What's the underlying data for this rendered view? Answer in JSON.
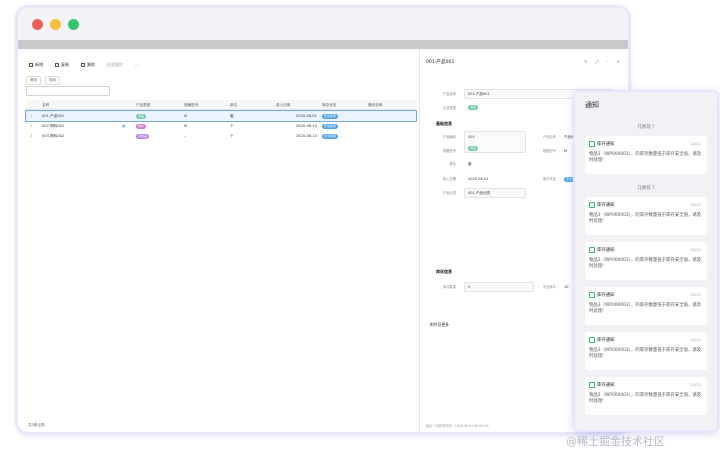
{
  "toolbar": {
    "new": "新增",
    "copy": "复制",
    "del": "删除",
    "filter_btn": "批量删除",
    "more": "⋯"
  },
  "filters": {
    "a": "筛选",
    "b": "排序",
    "c": "全部"
  },
  "table": {
    "headers": [
      "",
      "名称",
      "",
      "产品类型",
      "规格型号",
      "单位",
      "录入日期",
      "库存状态",
      "操作说明"
    ],
    "rows": [
      {
        "idx": "1",
        "name": "001-产品001",
        "type": "成品",
        "model": "M",
        "unit": "套",
        "date": "2020-06-01",
        "status": "安全库存"
      },
      {
        "idx": "2",
        "name": "002-物料001",
        "type": "物料",
        "model": "M",
        "unit": "个",
        "date": "2020-06-10",
        "status": "安全库存"
      },
      {
        "idx": "3",
        "name": "003-物料002",
        "type": "半成品",
        "model": "–",
        "unit": "个",
        "date": "2020-06-14",
        "status": "安全库存"
      }
    ],
    "footer": "共3条记录"
  },
  "detail": {
    "title": "001-产品001",
    "fields": {
      "name_label": "产品名称",
      "name_value": "001-产品001",
      "cat_label": "业务类型",
      "cat_value": "成品",
      "sec_basic": "基础信息",
      "code_label": "产品编码",
      "code_value": "001",
      "model_label": "规格型号",
      "model_value": "M",
      "unit_label": "单位",
      "unit_value": "套",
      "spec_label": "产品名称",
      "spec_value": "产品001",
      "date_label": "录入日期",
      "date_value": "2020-06-01",
      "type_label": "产品分类",
      "type_value": "001-产品分类",
      "stat_label": "库存状态",
      "stat_value": "安全库存",
      "sec_stock": "库存信息",
      "stock_label": "库存数量",
      "stock_value": "0",
      "safe_label": "安全库存",
      "safe_value": "10",
      "sec_other": "附件及更多"
    },
    "footer": "最近一次修改时间：2020-06-01 00:00:00"
  },
  "notice": {
    "title": "通知",
    "groups": [
      {
        "time": "几秒前 ?",
        "cards": [
          {
            "t": "库存通知",
            "d": "12/11",
            "b": "物品3（WP000003），的库存数量低于库存安全值，请及时处理!"
          }
        ]
      },
      {
        "time": "几秒前 ?",
        "cards": [
          {
            "t": "库存通知",
            "d": "12/11",
            "b": "物品3（WP000003），的库存数量低于库存安全值，请及时处理!"
          },
          {
            "t": "库存通知",
            "d": "12/11",
            "b": "物品3（WP000003），的库存数量低于库存安全值，请及时处理!"
          },
          {
            "t": "库存通知",
            "d": "12/11",
            "b": "物品3（WP000003），的库存数量低于库存安全值，请及时处理!"
          },
          {
            "t": "库存通知",
            "d": "12/11",
            "b": "物品3（WP000003），的库存数量低于库存安全值，请及时处理!"
          },
          {
            "t": "库存通知",
            "d": "12/11",
            "b": "物品3（WP000003），的库存数量低于库存安全值，请及时处理!"
          }
        ]
      }
    ]
  },
  "watermark": "@稀土掘金技术社区",
  "colors": {
    "accent": "#4fa4e8",
    "green": "#33c66b",
    "notice_border": "#e5e5fb"
  }
}
